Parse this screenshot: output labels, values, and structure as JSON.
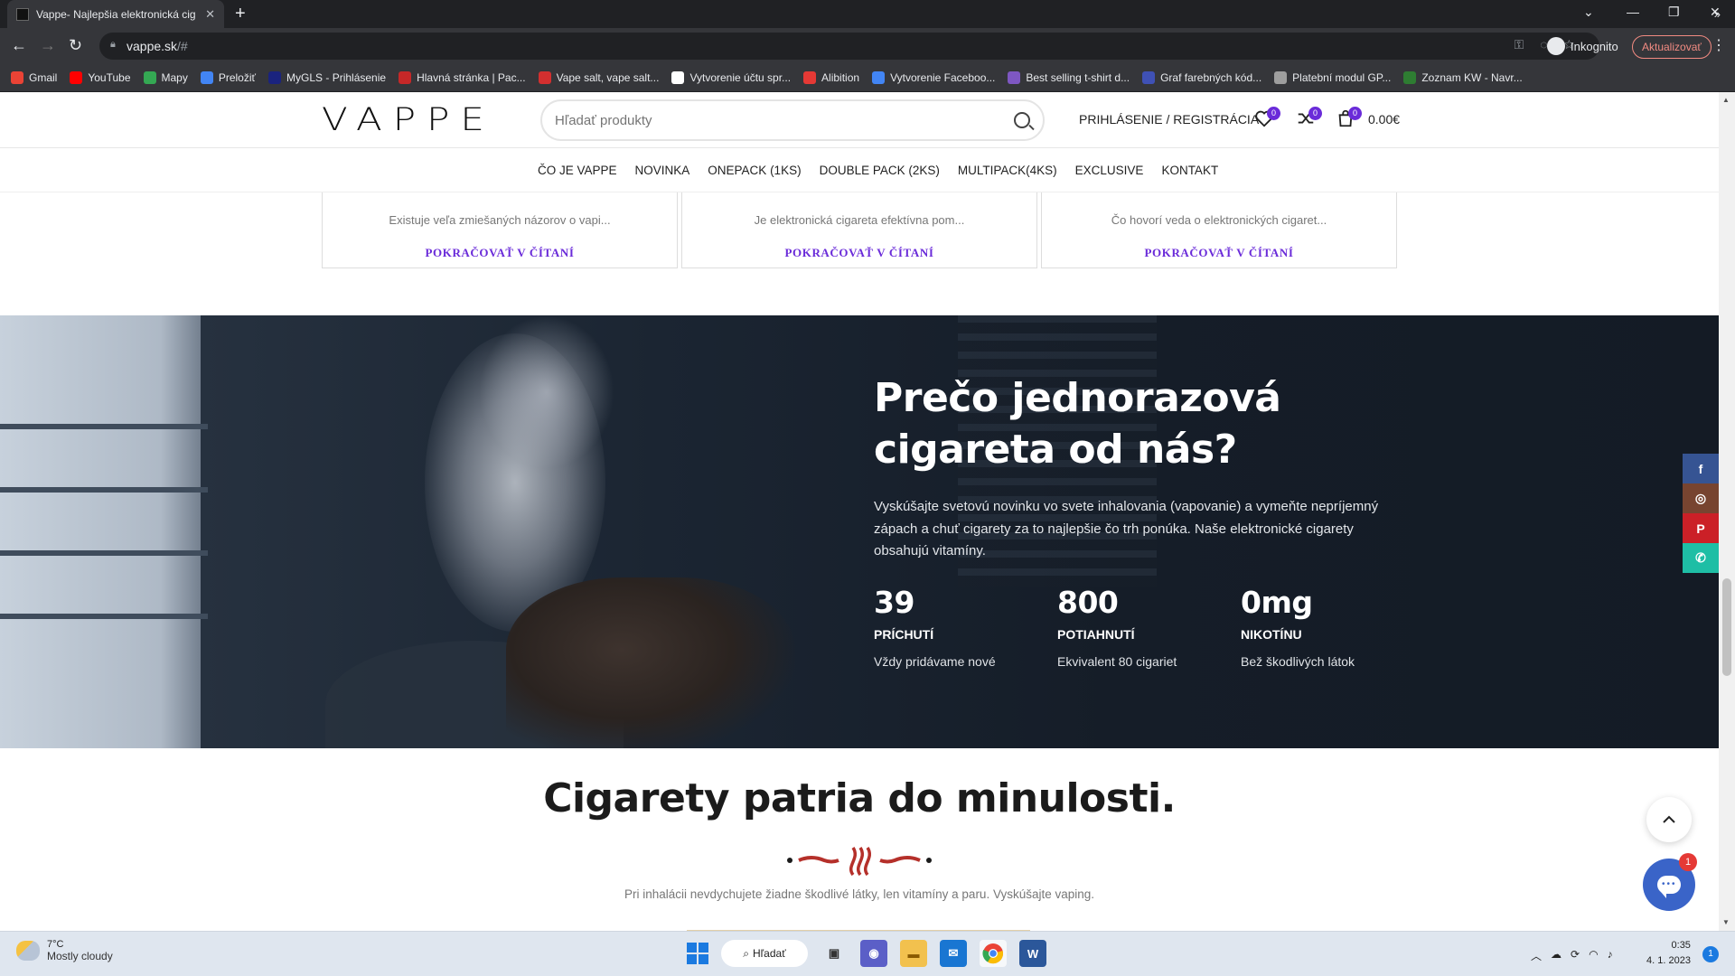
{
  "browser": {
    "tab_title": "Vappe- Najlepšia elektronická cig",
    "url_host": "vappe.sk",
    "url_path": "/#",
    "incognito_label": "Inkognito",
    "update_label": "Aktualizovať",
    "bookmarks": [
      {
        "label": "Gmail",
        "color": "#ea4335"
      },
      {
        "label": "YouTube",
        "color": "#ff0000"
      },
      {
        "label": "Mapy",
        "color": "#34a853"
      },
      {
        "label": "Preložiť",
        "color": "#4285f4"
      },
      {
        "label": "MyGLS - Prihlásenie",
        "color": "#1a237e"
      },
      {
        "label": "Hlavná stránka | Pac...",
        "color": "#c62828"
      },
      {
        "label": "Vape salt, vape salt...",
        "color": "#d32f2f"
      },
      {
        "label": "Vytvorenie účtu spr...",
        "color": "#ffffff"
      },
      {
        "label": "Alibition",
        "color": "#e53935"
      },
      {
        "label": "Vytvorenie Faceboo...",
        "color": "#4285f4"
      },
      {
        "label": "Best selling t-shirt d...",
        "color": "#7e57c2"
      },
      {
        "label": "Graf farebných kód...",
        "color": "#3f51b5"
      },
      {
        "label": "Platební modul GP...",
        "color": "#9e9e9e"
      },
      {
        "label": "Zoznam KW - Navr...",
        "color": "#2e7d32"
      }
    ]
  },
  "header": {
    "logo": "VAPPE",
    "search_placeholder": "Hľadať produkty",
    "login_label": "PRIHLÁSENIE / REGISTRÁCIA",
    "wishlist_count": "0",
    "compare_count": "0",
    "cart_count": "0",
    "cart_total": "0.00€"
  },
  "nav": {
    "items": [
      "ČO JE VAPPE",
      "NOVINKA",
      "ONEPACK (1KS)",
      "DOUBLE PACK (2KS)",
      "MULTIPACK(4KS)",
      "EXCLUSIVE",
      "KONTAKT"
    ]
  },
  "blog_cards": [
    {
      "excerpt": "Existuje veľa zmiešaných názorov o vapi...",
      "more": "POKRAČOVAŤ V ČÍTANÍ"
    },
    {
      "excerpt": "Je elektronická cigareta efektívna pom...",
      "more": "POKRAČOVAŤ V ČÍTANÍ"
    },
    {
      "excerpt": "Čo hovorí veda o elektronických cigaret...",
      "more": "POKRAČOVAŤ V ČÍTANÍ"
    }
  ],
  "hero": {
    "title": "Prečo jednorazová cigareta od nás?",
    "text": "Vyskúšajte svetovú novinku vo svete inhalovania (vapovanie) a vymeňte nepríjemný zápach a chuť cigarety za to najlepšie čo trh ponúka. Naše elektronické cigarety obsahujú vitamíny.",
    "stats": [
      {
        "num": "39",
        "label": "PRÍCHUTÍ",
        "sub": "Vždy pridávame nové"
      },
      {
        "num": "800",
        "label": "POTIAHNUTÍ",
        "sub": "Ekvivalent 80 cigariet"
      },
      {
        "num": "0mg",
        "label": "NIKOTÍNU",
        "sub": "Bež škodlivých látok"
      }
    ]
  },
  "social": [
    {
      "icon": "facebook-icon",
      "glyph": "f",
      "color": "#365493"
    },
    {
      "icon": "instagram-icon",
      "glyph": "◎",
      "color": "#774430"
    },
    {
      "icon": "pinterest-icon",
      "glyph": "P",
      "color": "#cb2027"
    },
    {
      "icon": "whatsapp-icon",
      "glyph": "✆",
      "color": "#1ebea5"
    }
  ],
  "section": {
    "title": "Cigarety patria do minulosti.",
    "subtitle": "Pri inhalácii nevdychujete žiadne škodlivé látky, len vitamíny a paru. Vyskúšajte vaping."
  },
  "chat_badge": "1",
  "taskbar": {
    "temperature": "7°C",
    "weather": "Mostly cloudy",
    "search_label": "Hľadať",
    "time": "0:35",
    "date": "4. 1. 2023",
    "notifications": "1"
  },
  "colors": {
    "accent": "#6a2bd9",
    "ornament": "#b5302a"
  }
}
